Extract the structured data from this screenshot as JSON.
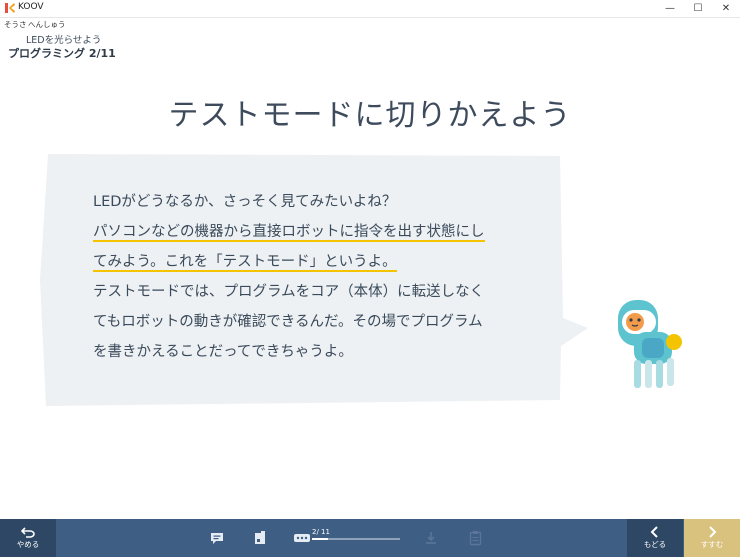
{
  "window": {
    "title": "KOOV",
    "minimize": "—",
    "maximize": "☐",
    "close": "✕"
  },
  "menu": {
    "items": [
      "そうさ",
      "へんしゅう"
    ]
  },
  "breadcrumb": "LEDを光らせよう",
  "section_title": "プログラミング 2/11",
  "heading": "テストモードに切りかえよう",
  "bubble": {
    "lines": [
      "LEDがどうなるか、さっそく見てみたいよね？",
      "パソコンなどの機器から直接ロボットに指令を出す状態にし",
      "てみよう。これを「テストモード」というよ。",
      "テストモードでは、プログラムをコア（本体）に転送しなく",
      "てもロボットの動きが確認できるんだ。その場でプログラム",
      "を書きかえることだってできちゃうよ。"
    ]
  },
  "footer": {
    "quit_label": "やめる",
    "back_label": "もどる",
    "next_label": "すすむ",
    "progress_text": "2/ 11",
    "progress_fraction": 0.18
  },
  "colors": {
    "accent": "#3f5e83",
    "dark": "#2d4764",
    "next": "#d8c27e",
    "highlight": "#f4c400",
    "bubble": "#edf1f4"
  }
}
